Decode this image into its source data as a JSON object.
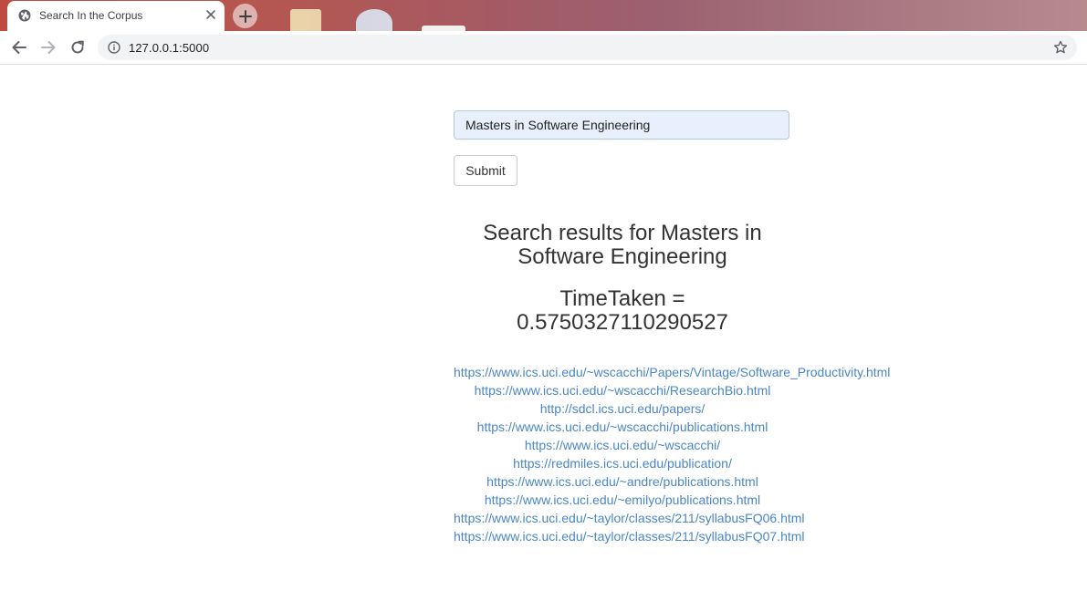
{
  "browser": {
    "tab_title": "Search In the Corpus",
    "url": "127.0.0.1:5000"
  },
  "form": {
    "query_value": "Masters in Software Engineering",
    "submit_label": "Submit"
  },
  "results": {
    "heading": "Search results for Masters in Software Engineering",
    "time_label": "TimeTaken = 0.5750327110290527",
    "links": [
      "https://www.ics.uci.edu/~wscacchi/Papers/Vintage/Software_Productivity.html",
      "https://www.ics.uci.edu/~wscacchi/ResearchBio.html",
      "http://sdcl.ics.uci.edu/papers/",
      "https://www.ics.uci.edu/~wscacchi/publications.html",
      "https://www.ics.uci.edu/~wscacchi/",
      "https://redmiles.ics.uci.edu/publication/",
      "https://www.ics.uci.edu/~andre/publications.html",
      "https://www.ics.uci.edu/~emilyo/publications.html",
      "https://www.ics.uci.edu/~taylor/classes/211/syllabusFQ06.html",
      "https://www.ics.uci.edu/~taylor/classes/211/syllabusFQ07.html"
    ]
  },
  "colors": {
    "link": "#4a86c5",
    "input_bg": "#e8f0fe",
    "text": "#333333"
  },
  "icons": {
    "favicon": "globe-icon",
    "tab_close": "close-icon",
    "new_tab": "plus-icon",
    "back": "back-arrow-icon",
    "forward": "forward-arrow-icon",
    "reload": "reload-icon",
    "site_info": "info-icon",
    "bookmark": "star-icon"
  }
}
